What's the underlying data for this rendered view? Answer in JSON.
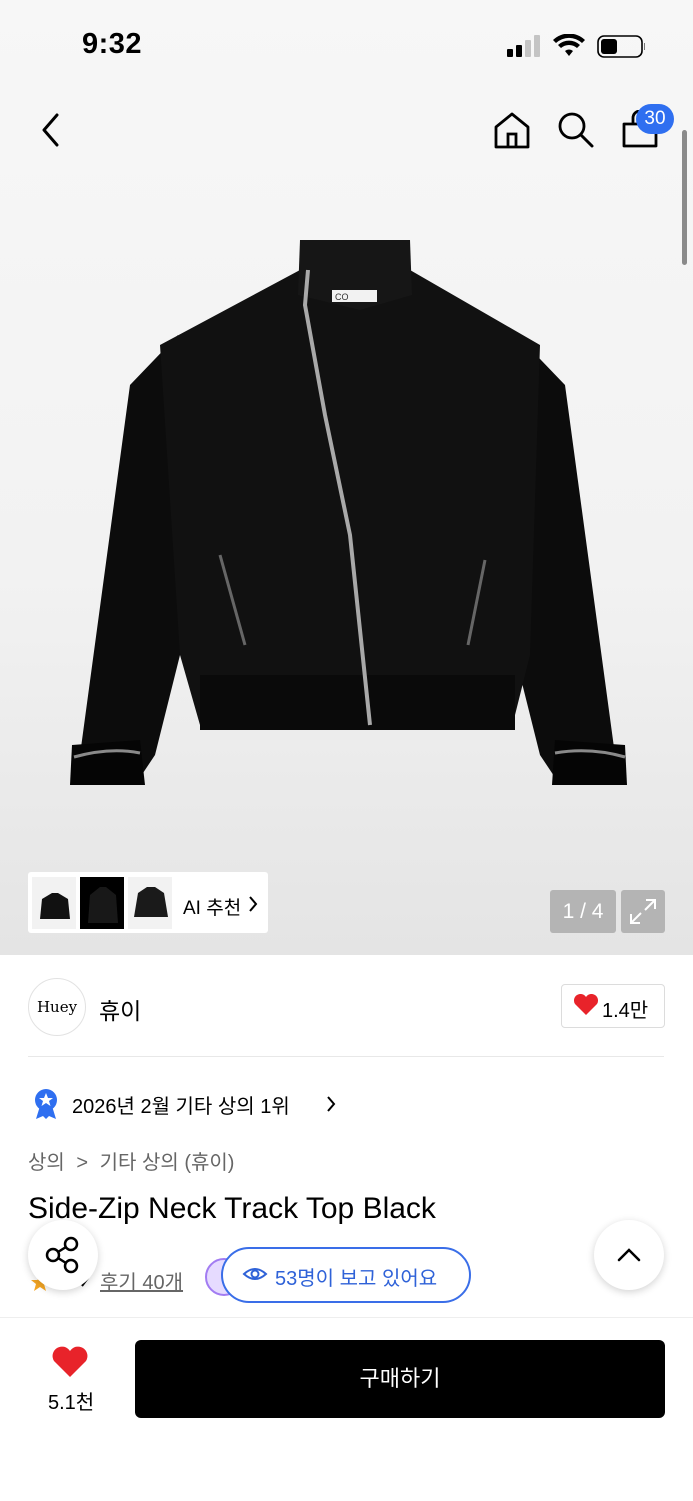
{
  "status_bar": {
    "time": "9:32"
  },
  "header": {
    "cart_badge": "30"
  },
  "gallery": {
    "ai_label": "AI 추천",
    "counter": "1 / 4",
    "garment_tag": "CO"
  },
  "brand": {
    "logo_text": "Huey",
    "name": "휴이",
    "like_count": "1.4만"
  },
  "ranking": {
    "text": "2026년 2월 기타 상의 1위"
  },
  "breadcrumb": {
    "first": "상의",
    "second": "기타 상의 (휴이)"
  },
  "product": {
    "title": "Side-Zip Neck Track Top Black",
    "review_text": "후기 40개"
  },
  "viewers": {
    "text": "53명이 보고 있어요"
  },
  "bottom": {
    "heart_count": "5.1천",
    "buy_label": "구매하기"
  },
  "colors": {
    "accent_blue": "#2f6ff0",
    "heart_red": "#e8232a",
    "buy_button": "#000000"
  }
}
